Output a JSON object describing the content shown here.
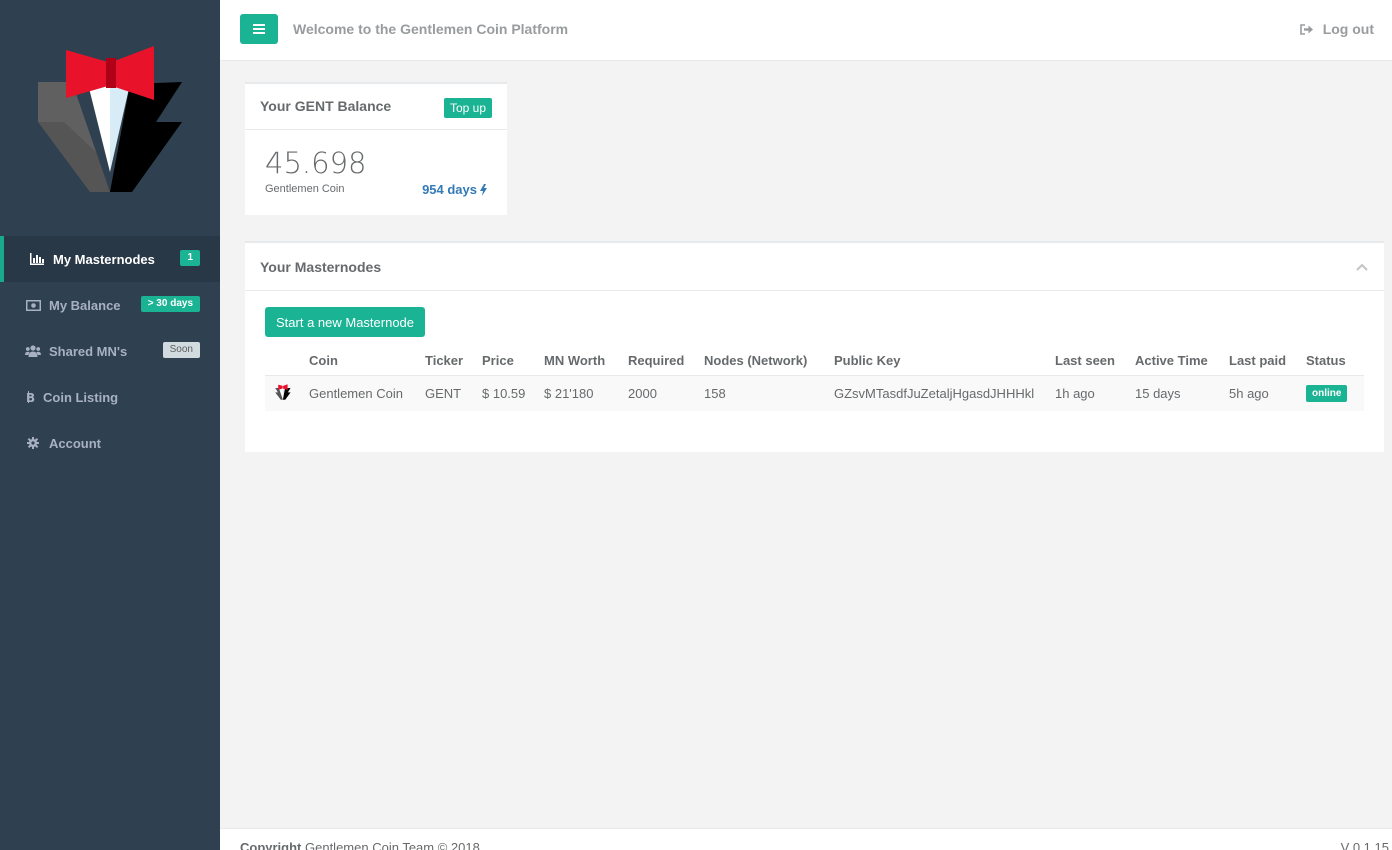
{
  "header": {
    "welcome": "Welcome to the Gentlemen Coin Platform",
    "logout_label": "Log out"
  },
  "sidebar": {
    "items": [
      {
        "label": "My Masternodes",
        "badge": "1",
        "icon": "bar-chart-icon"
      },
      {
        "label": "My Balance",
        "badge": "> 30 days",
        "icon": "money-icon"
      },
      {
        "label": "Shared MN's",
        "badge": "Soon",
        "icon": "users-icon"
      },
      {
        "label": "Coin Listing",
        "icon": "bitcoin-icon"
      },
      {
        "label": "Account",
        "icon": "gear-icon"
      }
    ]
  },
  "balance": {
    "title": "Your GENT Balance",
    "topup_label": "Top up",
    "value": "45.698",
    "unit": "Gentlemen Coin",
    "days": "954 days"
  },
  "masternodes": {
    "title": "Your Masternodes",
    "start_label": "Start a new Masternode",
    "columns": [
      "Coin",
      "Ticker",
      "Price",
      "MN Worth",
      "Required",
      "Nodes (Network)",
      "Public Key",
      "Last seen",
      "Active Time",
      "Last paid",
      "Status"
    ],
    "rows": [
      {
        "coin": "Gentlemen Coin",
        "ticker": "GENT",
        "price": "$ 10.59",
        "worth": "$ 21'180",
        "required": "2000",
        "nodes": "158",
        "pubkey": "GZsvMTasdfJuZetaljHgasdJHHHkl",
        "last_seen": "1h ago",
        "active_time": "15 days",
        "last_paid": "5h ago",
        "status": "online"
      }
    ]
  },
  "footer": {
    "copyright_bold": "Copyright",
    "copyright_rest": " Gentlemen Coin Team © 2018",
    "version": "V 0.1.15"
  },
  "colors": {
    "accent": "#1ab394",
    "sidebar": "#2f4050",
    "link": "#337ab7"
  }
}
